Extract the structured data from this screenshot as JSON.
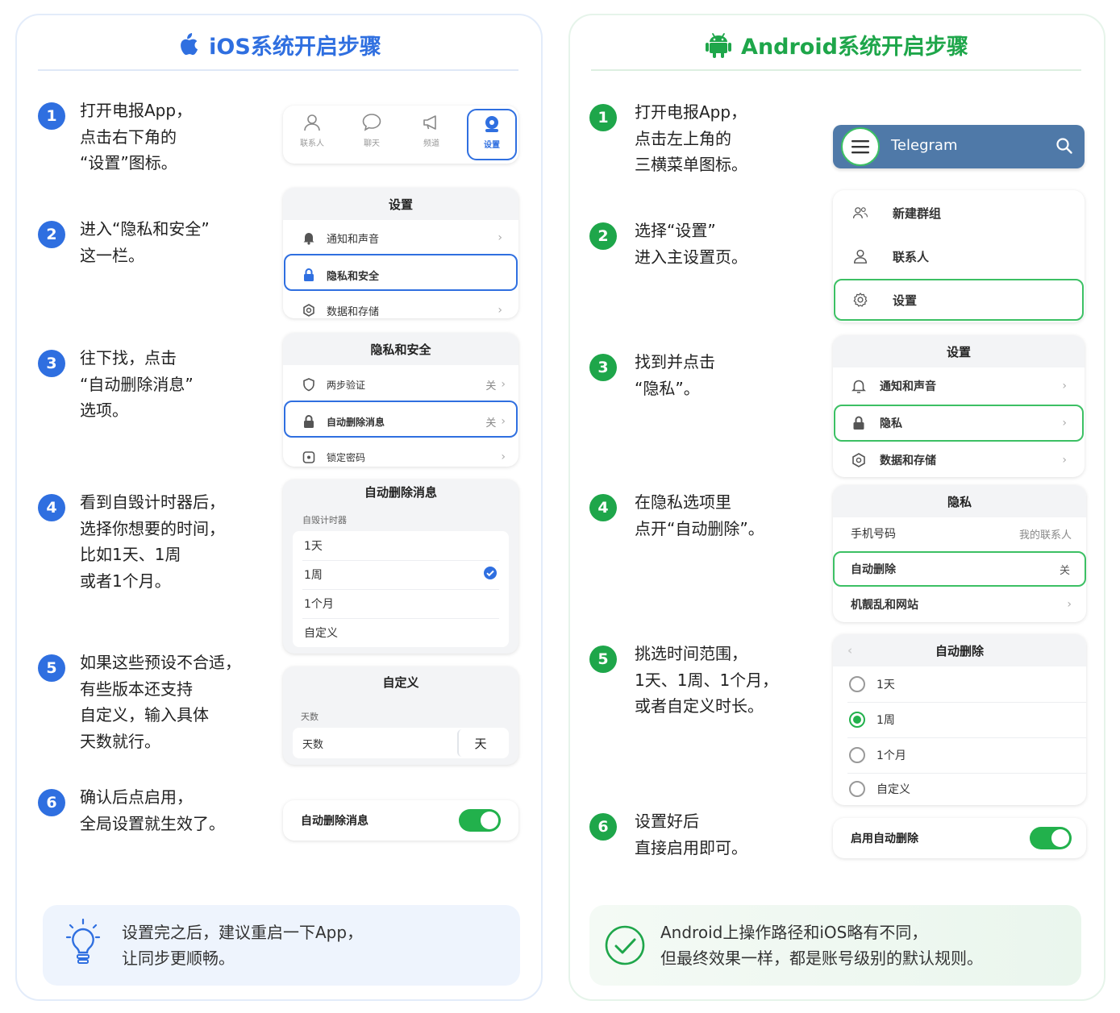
{
  "ios": {
    "title": "iOS系统开启步骤",
    "steps": [
      {
        "num": "1",
        "lines": [
          "打开电报App，",
          "点击右下角的",
          "“设置”图标。"
        ]
      },
      {
        "num": "2",
        "lines": [
          "进入“隐私和安全”",
          "这一栏。"
        ]
      },
      {
        "num": "3",
        "lines": [
          "往下找，点击",
          "“自动删除消息”",
          "选项。"
        ]
      },
      {
        "num": "4",
        "lines": [
          "看到自毁计时器后，",
          "选择你想要的时间，",
          "比如1天、1周",
          "或者1个月。"
        ]
      },
      {
        "num": "5",
        "lines": [
          "如果这些预设不合适，",
          "有些版本还支持",
          "自定义，输入具体",
          "天数就行。"
        ]
      },
      {
        "num": "6",
        "lines": [
          "确认后点启用，",
          "全局设置就生效了。"
        ]
      }
    ],
    "tabbar": {
      "tabs": [
        "联系人",
        "聊天",
        "频道",
        "设置"
      ]
    },
    "settings_card": {
      "title": "设置",
      "rows": [
        "通知和声音",
        "隐私和安全",
        "数据和存储"
      ]
    },
    "privacy_card": {
      "title": "隐私和安全",
      "rows": [
        {
          "label": "两步验证",
          "value": "关"
        },
        {
          "label": "自动删除消息",
          "value": "关"
        },
        {
          "label": "锁定密码",
          "value": ""
        }
      ]
    },
    "autodelete_card": {
      "title": "自动删除消息",
      "section": "自毁计时器",
      "options": [
        "1天",
        "1周",
        "1个月",
        "自定义"
      ],
      "selected": "1周"
    },
    "custom_card": {
      "title": "自定义",
      "section": "天数",
      "field_label": "天数",
      "unit": "天"
    },
    "toggle_card": {
      "label": "自动删除消息",
      "on": true
    },
    "note": [
      "设置完之后，建议重启一下App，",
      "让同步更顺畅。"
    ]
  },
  "android": {
    "title": "Android系统开启步骤",
    "steps": [
      {
        "num": "1",
        "lines": [
          "打开电报App，",
          "点击左上角的",
          "三横菜单图标。"
        ]
      },
      {
        "num": "2",
        "lines": [
          "选择“设置”",
          "进入主设置页。"
        ]
      },
      {
        "num": "3",
        "lines": [
          "找到并点击",
          "“隐私”。"
        ]
      },
      {
        "num": "4",
        "lines": [
          "在隐私选项里",
          "点开“自动删除”。"
        ]
      },
      {
        "num": "5",
        "lines": [
          "挑选时间范围，",
          "1天、1周、1个月，",
          "或者自定义时长。"
        ]
      },
      {
        "num": "6",
        "lines": [
          "设置好后",
          "直接启用即可。"
        ]
      }
    ],
    "appbar": {
      "title": "Telegram"
    },
    "menu_card": {
      "rows": [
        "新建群组",
        "联系人",
        "设置"
      ]
    },
    "settings_card": {
      "title": "设置",
      "rows": [
        "通知和声音",
        "隐私",
        "数据和存储"
      ]
    },
    "privacy_card": {
      "title": "隐私",
      "rows": [
        {
          "label": "手机号码",
          "value": "我的联系人"
        },
        {
          "label": "自动删除",
          "value": "关"
        },
        {
          "label": "机靓乱和网站",
          "value": ""
        }
      ]
    },
    "autodelete_card": {
      "title": "自动删除",
      "options": [
        "1天",
        "1周",
        "1个月",
        "自定义"
      ],
      "selected": "1周"
    },
    "toggle_card": {
      "label": "启用自动删除",
      "on": true
    },
    "note": [
      "Android上操作路径和iOS略有不同，",
      "但最终效果一样，都是账号级别的默认规则。"
    ]
  },
  "colors": {
    "ios_accent": "#2f6fe0",
    "android_accent": "#1ea64a",
    "toggle_on": "#22b14c"
  }
}
